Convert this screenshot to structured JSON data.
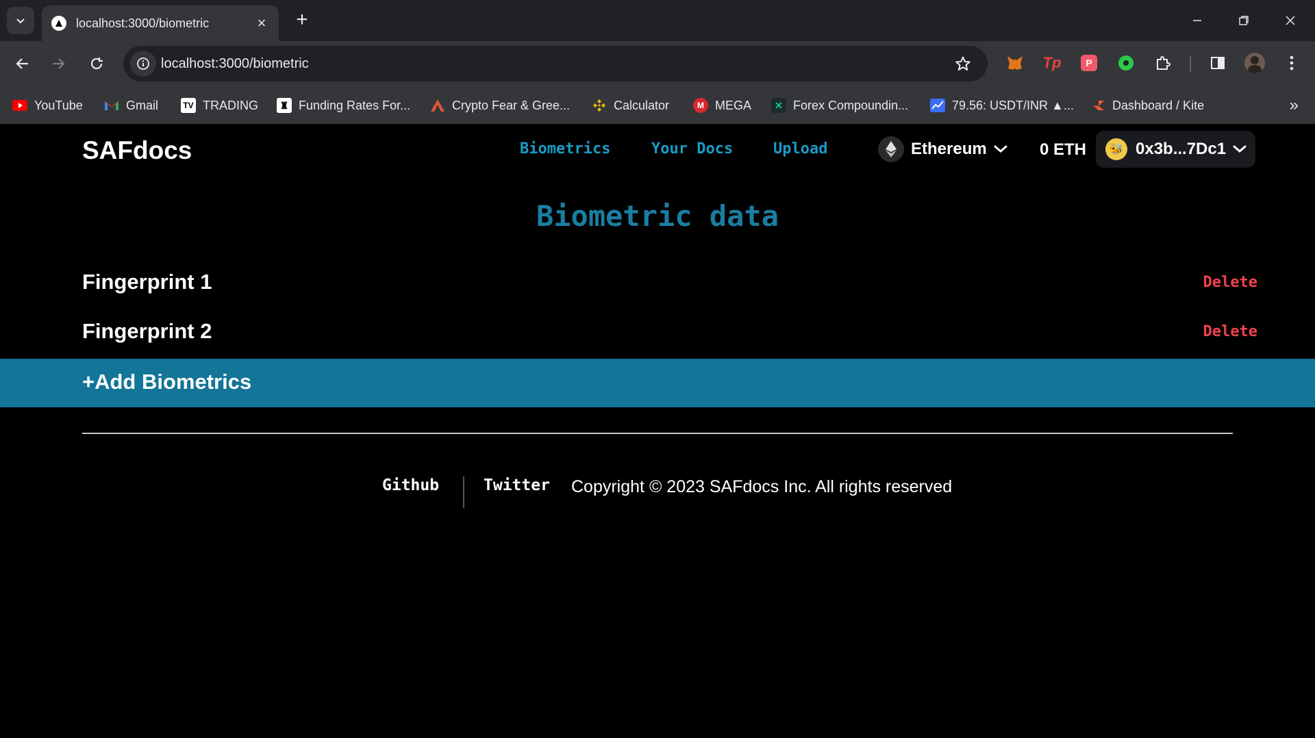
{
  "browser": {
    "tab_title": "localhost:3000/biometric",
    "url": "localhost:3000/biometric",
    "bookmarks": [
      {
        "label": "YouTube",
        "icon": "youtube-icon",
        "color": "#ff0000"
      },
      {
        "label": "Gmail",
        "icon": "gmail-icon",
        "color": "#ea4335"
      },
      {
        "label": "TRADING",
        "icon": "tradingview-icon",
        "color": "#ffffff"
      },
      {
        "label": "Funding Rates For...",
        "icon": "funding-icon",
        "color": "#ffffff"
      },
      {
        "label": "Crypto Fear & Gree...",
        "icon": "alternative-icon",
        "color": "#e0553b"
      },
      {
        "label": "Calculator",
        "icon": "binance-icon",
        "color": "#f0b90b"
      },
      {
        "label": "MEGA",
        "icon": "mega-icon",
        "color": "#d9272e"
      },
      {
        "label": "Forex Compoundin...",
        "icon": "forex-icon",
        "color": "#16c784"
      },
      {
        "label": "79.56: USDT/INR ▲...",
        "icon": "chart-icon",
        "color": "#3b6ef5"
      },
      {
        "label": "Dashboard / Kite",
        "icon": "kite-icon",
        "color": "#f25a2c"
      }
    ]
  },
  "app": {
    "logo": "SAFdocs",
    "nav": [
      "Biometrics",
      "Your Docs",
      "Upload"
    ],
    "chain": "Ethereum",
    "balance": "0 ETH",
    "account": "0x3b...7Dc1",
    "heading": "Biometric data",
    "biometrics": [
      {
        "label": "Fingerprint 1",
        "action": "Delete"
      },
      {
        "label": "Fingerprint 2",
        "action": "Delete"
      }
    ],
    "add_label": "+Add Biometrics",
    "footer": {
      "github": "Github",
      "twitter": "Twitter",
      "copyright": "Copyright © 2023 SAFdocs Inc. All rights reserved"
    }
  },
  "colors": {
    "accent": "#137597",
    "nav_link": "#1a9bc6",
    "delete": "#f0424f"
  }
}
